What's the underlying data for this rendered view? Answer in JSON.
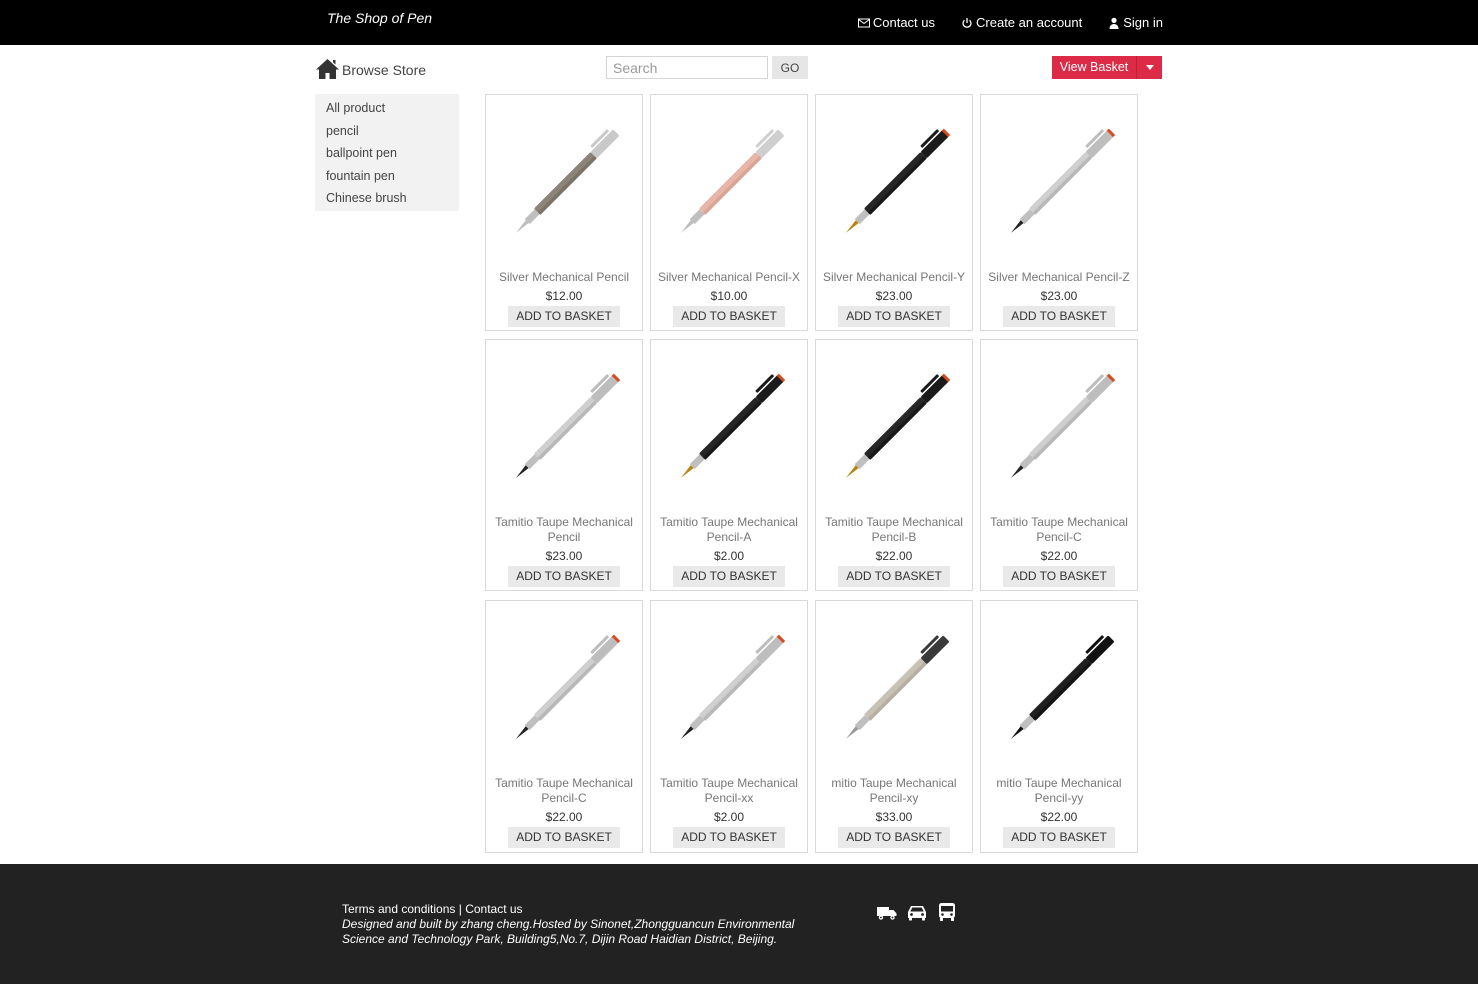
{
  "header": {
    "brand": "The Shop of Pen",
    "nav": [
      {
        "label": "Contact us",
        "icon": "envelope-icon"
      },
      {
        "label": "Create an account",
        "icon": "power-icon"
      },
      {
        "label": "Sign in",
        "icon": "user-icon"
      }
    ]
  },
  "browse": {
    "label": "Browse Store",
    "icon": "home-icon"
  },
  "search": {
    "placeholder": "Search",
    "go_label": "GO"
  },
  "basket": {
    "label": "View Basket",
    "color": "#dc2a47"
  },
  "sidebar": {
    "items": [
      {
        "label": "All product"
      },
      {
        "label": "pencil"
      },
      {
        "label": "ballpoint pen"
      },
      {
        "label": "fountain pen"
      },
      {
        "label": "Chinese brush"
      }
    ]
  },
  "products": [
    {
      "name": "Silver Mechanical Pencil",
      "price": "$12.00",
      "button": "ADD TO BASKET",
      "style": "taupe"
    },
    {
      "name": "Silver Mechanical Pencil-X",
      "price": "$10.00",
      "button": "ADD TO BASKET",
      "style": "pink"
    },
    {
      "name": "Silver Mechanical Pencil-Y",
      "price": "$23.00",
      "button": "ADD TO BASKET",
      "style": "black"
    },
    {
      "name": "Silver Mechanical Pencil-Z",
      "price": "$23.00",
      "button": "ADD TO BASKET",
      "style": "silver"
    },
    {
      "name": "Tamitio Taupe Mechanical Pencil",
      "price": "$23.00",
      "button": "ADD TO BASKET",
      "style": "silver"
    },
    {
      "name": "Tamitio Taupe Mechanical Pencil-A",
      "price": "$2.00",
      "button": "ADD TO BASKET",
      "style": "black"
    },
    {
      "name": "Tamitio Taupe Mechanical Pencil-B",
      "price": "$22.00",
      "button": "ADD TO BASKET",
      "style": "black"
    },
    {
      "name": "Tamitio Taupe Mechanical Pencil-C",
      "price": "$22.00",
      "button": "ADD TO BASKET",
      "style": "silver"
    },
    {
      "name": "Tamitio Taupe Mechanical Pencil-C",
      "price": "$22.00",
      "button": "ADD TO BASKET",
      "style": "silver"
    },
    {
      "name": "Tamitio Taupe Mechanical Pencil-xx",
      "price": "$2.00",
      "button": "ADD TO BASKET",
      "style": "silver"
    },
    {
      "name": "mitio Taupe Mechanical Pencil-xy",
      "price": "$33.00",
      "button": "ADD TO BASKET",
      "style": "champagne"
    },
    {
      "name": "mitio Taupe Mechanical Pencil-yy",
      "price": "$22.00",
      "button": "ADD TO BASKET",
      "style": "stylus-black"
    }
  ],
  "footer": {
    "terms": "Terms and conditions",
    "separator": " | ",
    "contact": "Contact us",
    "credit": "Designed and built by zhang cheng.Hosted by Sinonet,Zhongguancun Environmental Science and Technology Park, Building5,No.7, Dijin Road Haidian District, Beijing.",
    "icons": [
      "truck-icon",
      "car-icon",
      "bus-icon"
    ]
  }
}
